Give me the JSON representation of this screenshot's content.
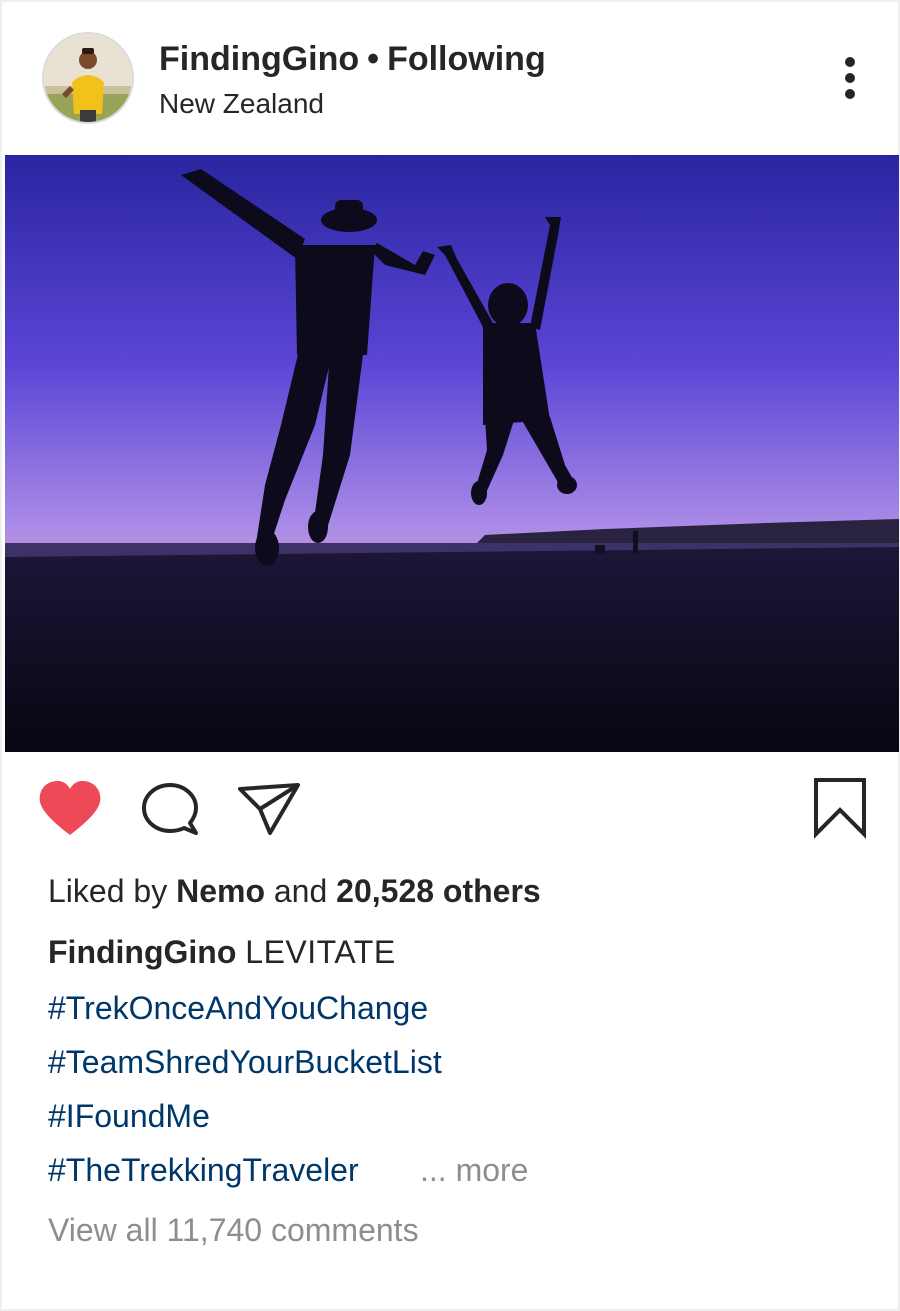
{
  "header": {
    "username": "FindingGino",
    "separator": "•",
    "follow_status": "Following",
    "location": "New Zealand",
    "more_icon": "more-vertical-icon"
  },
  "post_image": {
    "description_icon": "photo",
    "sky_colors": [
      "#2a25a0",
      "#5b45d6",
      "#a98ae6",
      "#e6a8d8",
      "#d0629e"
    ]
  },
  "actions": {
    "like_icon": "heart-filled-icon",
    "like_color": "#ed4956",
    "comment_icon": "comment-icon",
    "share_icon": "send-icon",
    "save_icon": "bookmark-icon"
  },
  "likes": {
    "prefix": "Liked by",
    "first_liker": "Nemo",
    "conjunction": "and",
    "others": "20,528 others"
  },
  "caption": {
    "author": "FindingGino",
    "text": "LEVITATE",
    "hashtags": [
      "#TrekOnceAndYouChange",
      "#TeamShredYourBucketList",
      "#IFoundMe",
      "#TheTrekkingTraveler"
    ],
    "more_label": "... more"
  },
  "comments": {
    "view_all_label": "View all 11,740 comments"
  },
  "colors": {
    "text": "#262626",
    "link": "#00376b",
    "muted": "#8e8e8e",
    "like": "#ed4956"
  }
}
